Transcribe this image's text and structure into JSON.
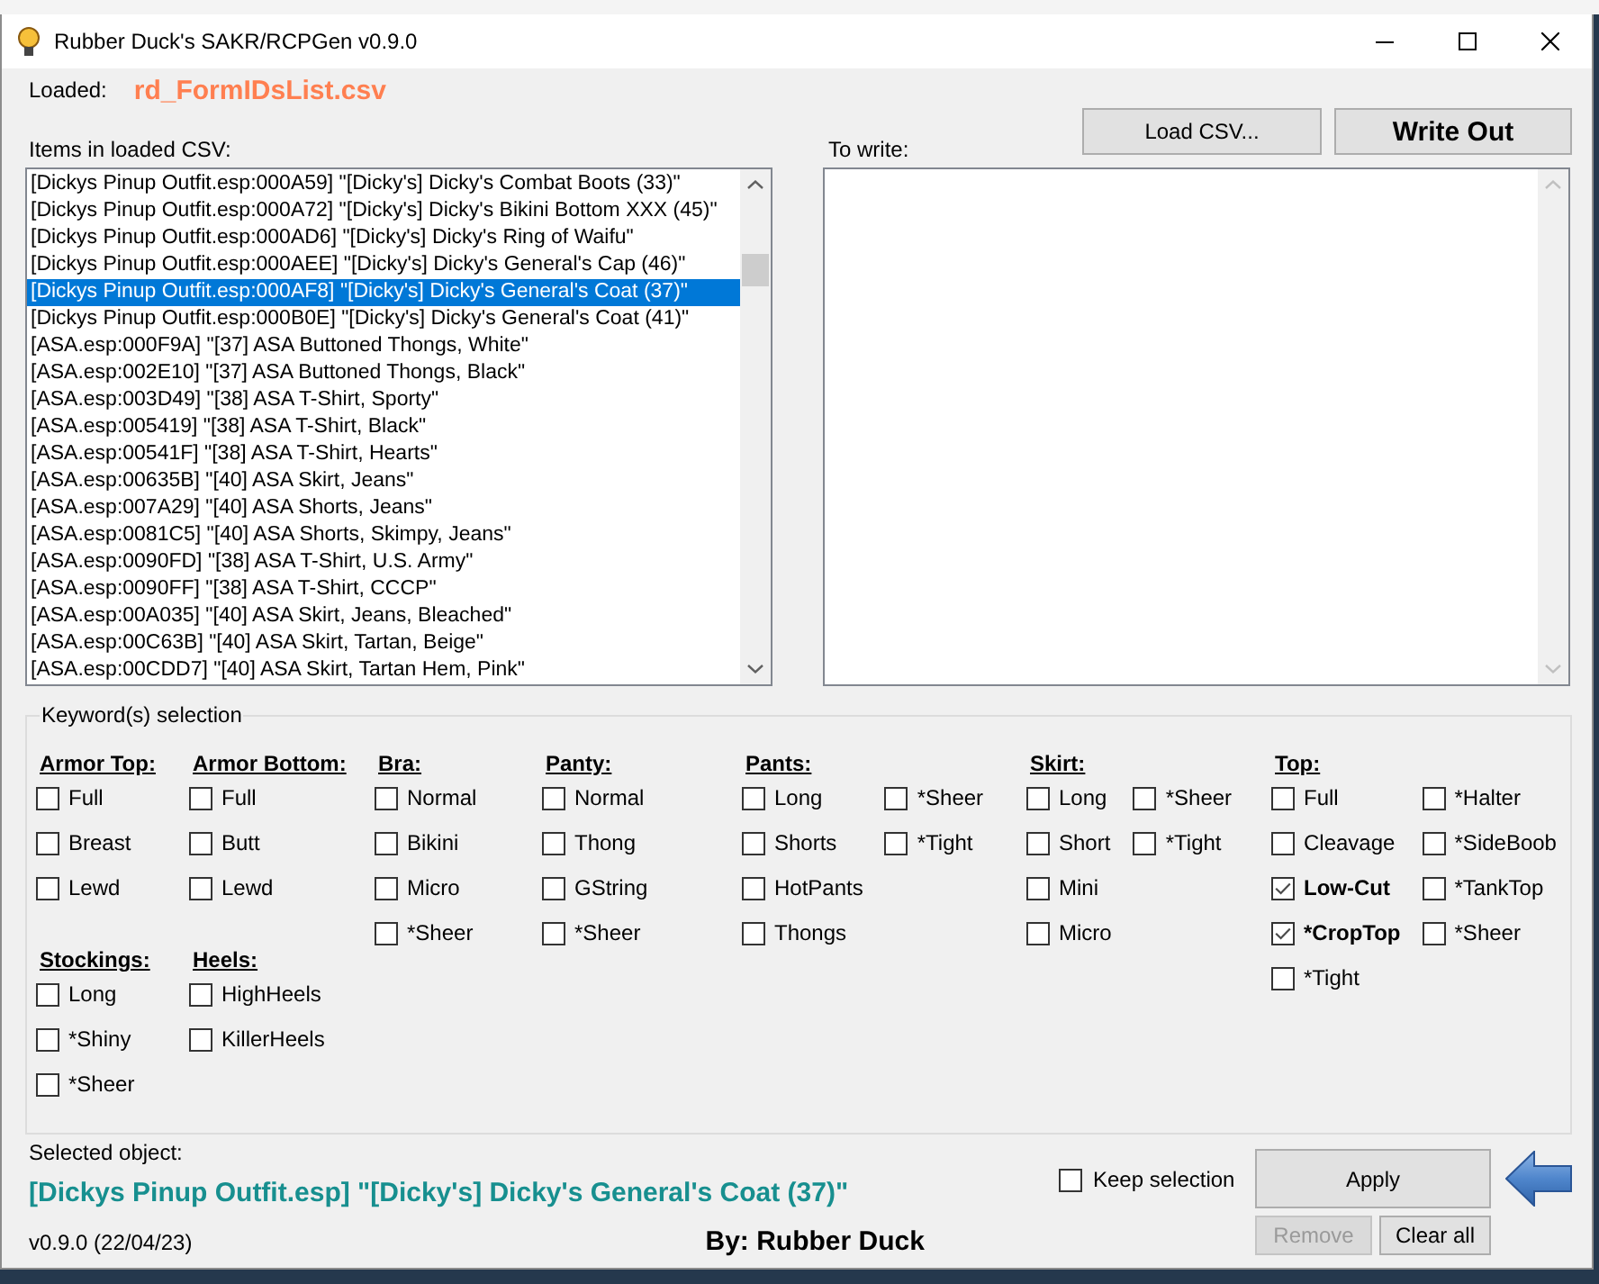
{
  "window": {
    "title": "Rubber Duck's SAKR/RCPGen v0.9.0"
  },
  "loaded": {
    "label": "Loaded:",
    "value": "rd_FormIDsList.csv"
  },
  "load_button": {
    "label": "Load CSV..."
  },
  "write_button": {
    "label": "Write Out"
  },
  "items_list": {
    "label": "Items in loaded CSV:",
    "items": [
      {
        "text": "[Dickys Pinup Outfit.esp:000A59] \"[Dicky's] Dicky's Combat Boots (33)\"",
        "selected": false
      },
      {
        "text": "[Dickys Pinup Outfit.esp:000A72] \"[Dicky's] Dicky's Bikini Bottom XXX (45)\"",
        "selected": false
      },
      {
        "text": "[Dickys Pinup Outfit.esp:000AD6] \"[Dicky's] Dicky's Ring of Waifu\"",
        "selected": false
      },
      {
        "text": "[Dickys Pinup Outfit.esp:000AEE] \"[Dicky's] Dicky's General's Cap (46)\"",
        "selected": false
      },
      {
        "text": "[Dickys Pinup Outfit.esp:000AF8] \"[Dicky's] Dicky's General's Coat (37)\"",
        "selected": true
      },
      {
        "text": "[Dickys Pinup Outfit.esp:000B0E] \"[Dicky's] Dicky's General's Coat (41)\"",
        "selected": false
      },
      {
        "text": "[ASA.esp:000F9A] \"[37] ASA Buttoned Thongs, White\"",
        "selected": false
      },
      {
        "text": "[ASA.esp:002E10] \"[37] ASA Buttoned Thongs, Black\"",
        "selected": false
      },
      {
        "text": "[ASA.esp:003D49] \"[38] ASA T-Shirt, Sporty\"",
        "selected": false
      },
      {
        "text": "[ASA.esp:005419] \"[38] ASA T-Shirt, Black\"",
        "selected": false
      },
      {
        "text": "[ASA.esp:00541F] \"[38] ASA T-Shirt, Hearts\"",
        "selected": false
      },
      {
        "text": "[ASA.esp:00635B] \"[40] ASA Skirt, Jeans\"",
        "selected": false
      },
      {
        "text": "[ASA.esp:007A29] \"[40] ASA Shorts, Jeans\"",
        "selected": false
      },
      {
        "text": "[ASA.esp:0081C5] \"[40] ASA Shorts, Skimpy, Jeans\"",
        "selected": false
      },
      {
        "text": "[ASA.esp:0090FD] \"[38] ASA T-Shirt, U.S. Army\"",
        "selected": false
      },
      {
        "text": "[ASA.esp:0090FF] \"[38] ASA T-Shirt, CCCP\"",
        "selected": false
      },
      {
        "text": "[ASA.esp:00A035] \"[40] ASA Skirt, Jeans, Bleached\"",
        "selected": false
      },
      {
        "text": "[ASA.esp:00C63B] \"[40] ASA Skirt, Tartan, Beige\"",
        "selected": false
      },
      {
        "text": "[ASA.esp:00CDD7] \"[40] ASA Skirt, Tartan Hem, Pink\"",
        "selected": false
      }
    ]
  },
  "to_write": {
    "label": "To write:"
  },
  "keywords": {
    "title": "Keyword(s) selection",
    "columns": [
      {
        "groups": [
          {
            "heading": "Armor Top:",
            "lists": [
              [
                {
                  "label": "Full",
                  "checked": false
                },
                {
                  "label": "Breast",
                  "checked": false
                },
                {
                  "label": "Lewd",
                  "checked": false
                }
              ]
            ]
          },
          {
            "heading": "Stockings:",
            "lists": [
              [
                {
                  "label": "Long",
                  "checked": false
                },
                {
                  "label": "*Shiny",
                  "checked": false
                },
                {
                  "label": "*Sheer",
                  "checked": false
                }
              ]
            ]
          }
        ]
      },
      {
        "groups": [
          {
            "heading": "Armor Bottom:",
            "lists": [
              [
                {
                  "label": "Full",
                  "checked": false
                },
                {
                  "label": "Butt",
                  "checked": false
                },
                {
                  "label": "Lewd",
                  "checked": false
                }
              ]
            ]
          },
          {
            "heading": "Heels:",
            "lists": [
              [
                {
                  "label": "HighHeels",
                  "checked": false
                },
                {
                  "label": "KillerHeels",
                  "checked": false
                }
              ]
            ]
          }
        ]
      },
      {
        "groups": [
          {
            "heading": "Bra:",
            "lists": [
              [
                {
                  "label": "Normal",
                  "checked": false
                },
                {
                  "label": "Bikini",
                  "checked": false
                },
                {
                  "label": "Micro",
                  "checked": false
                },
                {
                  "label": "*Sheer",
                  "checked": false
                }
              ]
            ]
          }
        ]
      },
      {
        "groups": [
          {
            "heading": "Panty:",
            "lists": [
              [
                {
                  "label": "Normal",
                  "checked": false
                },
                {
                  "label": "Thong",
                  "checked": false
                },
                {
                  "label": "GString",
                  "checked": false
                },
                {
                  "label": "*Sheer",
                  "checked": false
                }
              ]
            ]
          }
        ]
      },
      {
        "groups": [
          {
            "heading": "Pants:",
            "lists": [
              [
                {
                  "label": "Long",
                  "checked": false
                },
                {
                  "label": "Shorts",
                  "checked": false
                },
                {
                  "label": "HotPants",
                  "checked": false
                },
                {
                  "label": "Thongs",
                  "checked": false
                }
              ],
              [
                {
                  "label": "*Sheer",
                  "checked": false
                },
                {
                  "label": "*Tight",
                  "checked": false
                }
              ]
            ]
          }
        ]
      },
      {
        "groups": [
          {
            "heading": "Skirt:",
            "lists": [
              [
                {
                  "label": "Long",
                  "checked": false
                },
                {
                  "label": "Short",
                  "checked": false
                },
                {
                  "label": "Mini",
                  "checked": false
                },
                {
                  "label": "Micro",
                  "checked": false
                }
              ],
              [
                {
                  "label": "*Sheer",
                  "checked": false
                },
                {
                  "label": "*Tight",
                  "checked": false
                }
              ]
            ]
          }
        ]
      },
      {
        "groups": [
          {
            "heading": "Top:",
            "lists": [
              [
                {
                  "label": "Full",
                  "checked": false
                },
                {
                  "label": "Cleavage",
                  "checked": false
                },
                {
                  "label": "Low-Cut",
                  "checked": true
                },
                {
                  "label": "*CropTop",
                  "checked": true
                },
                {
                  "label": "*Tight",
                  "checked": false
                }
              ],
              [
                {
                  "label": "*Halter",
                  "checked": false
                },
                {
                  "label": "*SideBoob",
                  "checked": false
                },
                {
                  "label": "*TankTop",
                  "checked": false
                },
                {
                  "label": "*Sheer",
                  "checked": false
                }
              ]
            ]
          }
        ]
      }
    ]
  },
  "selected_object": {
    "label": "Selected object:",
    "value": "[Dickys Pinup Outfit.esp] \"[Dicky's] Dicky's General's Coat (37)\""
  },
  "keep_selection": {
    "label": "Keep selection",
    "checked": false
  },
  "apply_button": {
    "label": "Apply"
  },
  "small_buttons": [
    {
      "label": "Remove",
      "disabled": true
    },
    {
      "label": "Clear all",
      "disabled": false
    }
  ],
  "version": "v0.9.0 (22/04/23)",
  "author": "By: Rubber Duck"
}
